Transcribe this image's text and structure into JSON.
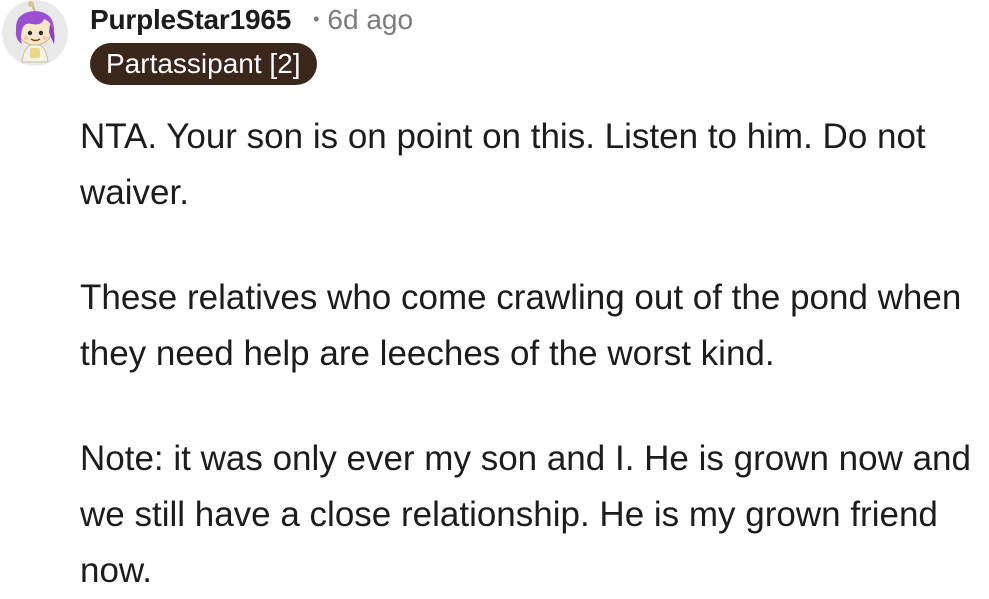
{
  "comment": {
    "avatar_icon": "snoo-avatar-icon",
    "username": "PurpleStar1965",
    "separator": "•",
    "timestamp": "6d ago",
    "flair": "Partassipant [2]",
    "paragraphs": [
      "NTA. Your son is on point on this. Listen to him. Do not waiver.",
      "These relatives who come crawling out of the pond when they need help are leeches of the worst kind.",
      "Note: it was only ever my son and I. He is grown now and we still have a close relationship. He is my grown friend now."
    ]
  },
  "colors": {
    "text": "#1c1c1c",
    "meta": "#7c7c7c",
    "flair_bg": "#3b261c",
    "flair_text": "#ffffff",
    "avatar_hair": "#9b4fd1"
  }
}
